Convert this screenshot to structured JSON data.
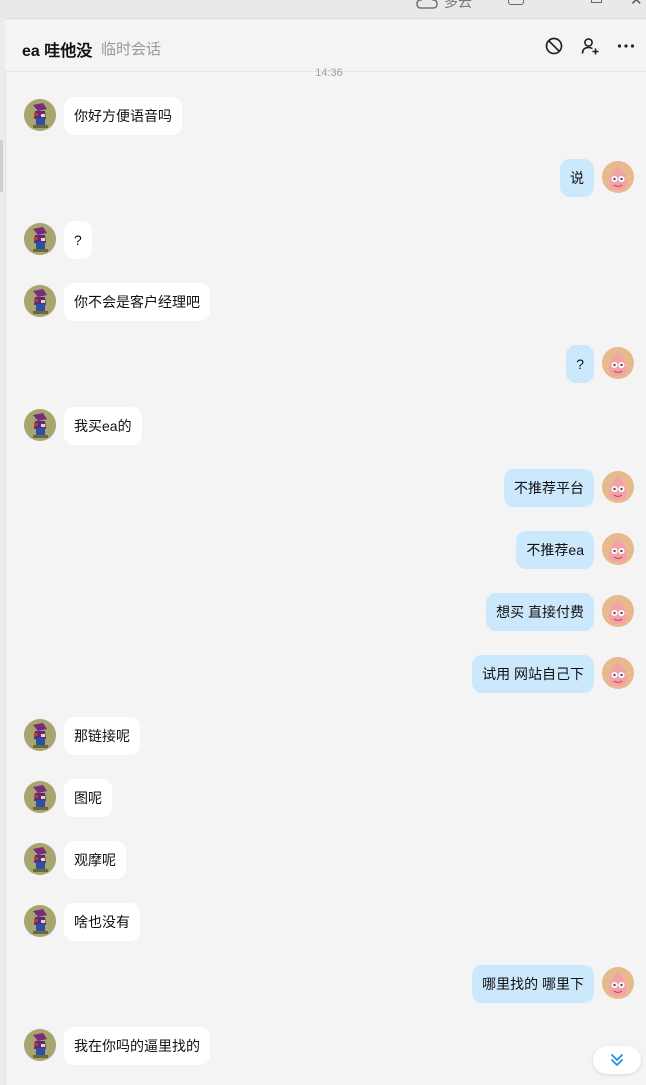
{
  "titlebar": {
    "cloud_label": "多云"
  },
  "header": {
    "name": "ea 哇他没",
    "tag": "临时会话",
    "icons": [
      "block-icon",
      "add-friend-icon",
      "more-icon"
    ]
  },
  "timestamp": "14:36",
  "messages": [
    {
      "side": "left",
      "text": "你好方便语音吗"
    },
    {
      "side": "right",
      "text": "说"
    },
    {
      "side": "left",
      "text": "?"
    },
    {
      "side": "left",
      "text": "你不会是客户经理吧"
    },
    {
      "side": "right",
      "text": "?"
    },
    {
      "side": "left",
      "text": "我买ea的"
    },
    {
      "side": "right",
      "text": "不推荐平台"
    },
    {
      "side": "right",
      "text": "不推荐ea"
    },
    {
      "side": "right",
      "text": "想买 直接付费"
    },
    {
      "side": "right",
      "text": "试用 网站自己下"
    },
    {
      "side": "left",
      "text": "那链接呢"
    },
    {
      "side": "left",
      "text": "图呢"
    },
    {
      "side": "left",
      "text": "观摩呢"
    },
    {
      "side": "left",
      "text": "啥也没有"
    },
    {
      "side": "right",
      "text": "哪里找的 哪里下"
    },
    {
      "side": "left",
      "text": "我在你吗的逼里找的"
    }
  ],
  "colors": {
    "background": "#f4f4f4",
    "incoming_bubble": "#ffffff",
    "outgoing_bubble": "#cce8fd",
    "tag_text": "#999999"
  }
}
